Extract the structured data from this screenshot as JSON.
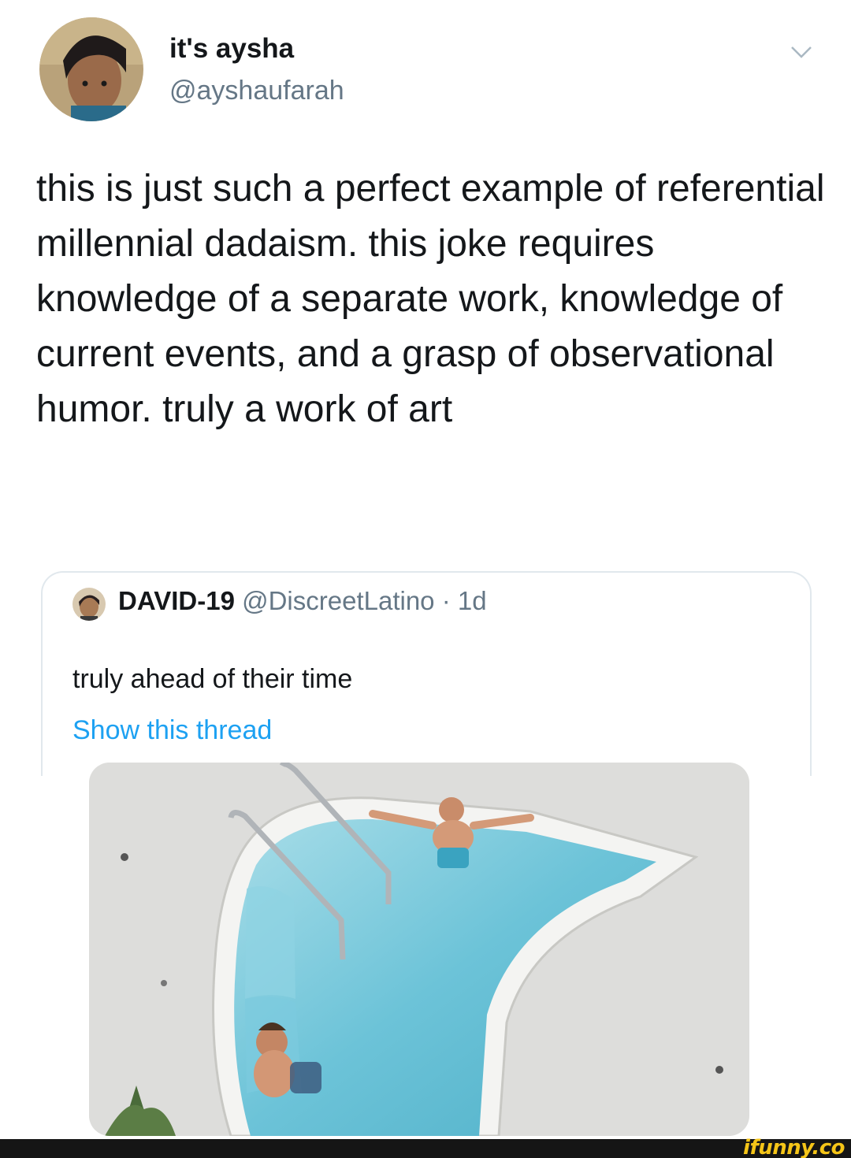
{
  "tweet": {
    "author": {
      "display_name": "it's aysha",
      "handle": "@ayshaufarah",
      "avatar_icon": "profile-photo"
    },
    "menu_icon": "chevron-down-icon",
    "text": "this is just such a perfect example of referential millennial dadaism. this joke requires knowledge of a separate work, knowledge of current events, and a grasp of observational humor. truly a work of art"
  },
  "quoted_tweet": {
    "author": {
      "display_name": "DAVID-19",
      "handle": "@DiscreetLatino",
      "separator": " · ",
      "time": "1d",
      "avatar_icon": "profile-photo"
    },
    "text": "truly ahead of their time",
    "show_thread": "Show this thread",
    "media_description_icon": "hot-tub-photo"
  },
  "watermark": "ifunny.co",
  "colors": {
    "text": "#14171a",
    "secondary": "#657786",
    "link": "#1da1f2",
    "border": "#e1e8ed",
    "watermark": "#f5c518"
  }
}
